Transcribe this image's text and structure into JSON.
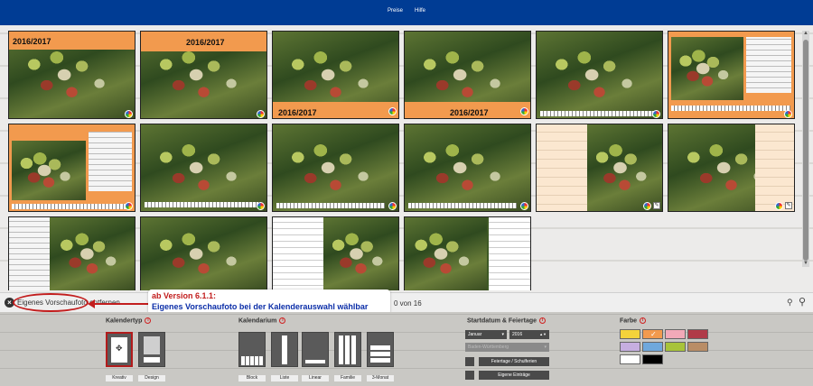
{
  "nav": {
    "items": [
      "Preise",
      "Hilfe"
    ]
  },
  "thumbnails": {
    "year_label": "2016/2017"
  },
  "statusbar": {
    "remove_label": "Eigenes Vorschaufoto entfernen",
    "count": "0 von 16"
  },
  "callout": {
    "line1": "ab Version 6.1.1:",
    "line2": "Eigenes Vorschaufoto bei der Kalenderauswahl wählbar"
  },
  "options": {
    "kalendertyp": {
      "title": "Kalendertyp",
      "tiles": [
        "Kreativ",
        "Design"
      ]
    },
    "kalendarium": {
      "title": "Kalendarium",
      "tiles": [
        "Block",
        "Liste",
        "Linear",
        "Familie",
        "3-Monat"
      ]
    },
    "startdatum": {
      "title": "Startdatum & Feiertage",
      "month": "Januar",
      "year": "2016",
      "region": "Baden-Württemberg",
      "holidays_button": "Feiertage / Schulferien",
      "own_entries_button": "Eigene Einträge"
    },
    "farbe": {
      "title": "Farbe",
      "swatches": [
        "#f4d33b",
        "#f29a4e",
        "#f2a9b8",
        "#b03a48",
        "#c6aee0",
        "#6fa8dc",
        "#a8c33a",
        "#b98d66",
        "#ffffff",
        "#000000"
      ]
    }
  }
}
